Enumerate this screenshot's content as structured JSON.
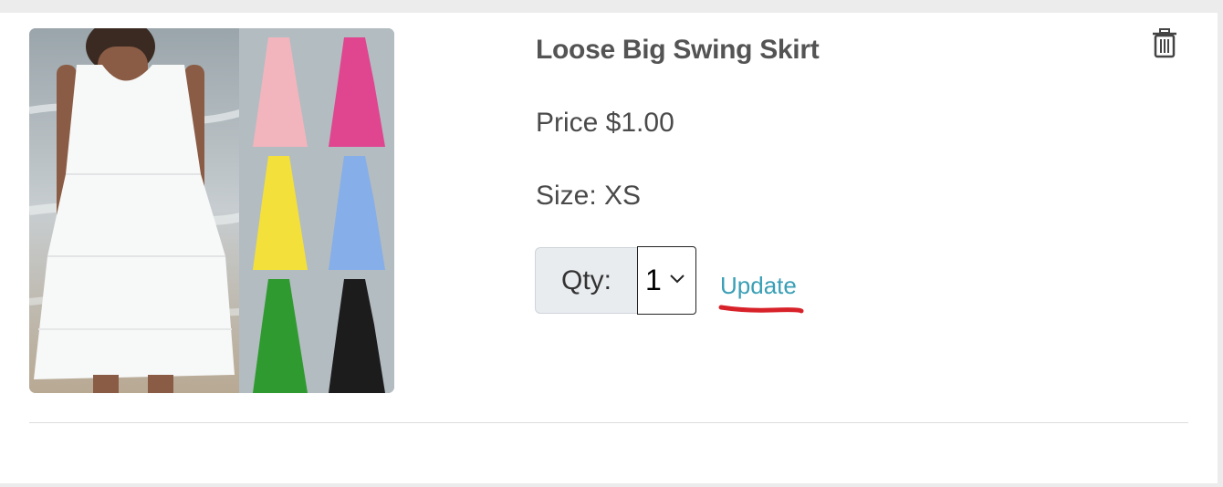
{
  "product": {
    "title": "Loose Big Swing Skirt",
    "price": "Price $1.00",
    "size": "Size: XS",
    "image_icon": "dress-photo",
    "color_variants": [
      "#f2b5bd",
      "#e0458f",
      "#f3e03a",
      "#86aee8",
      "#2f9a2f",
      "#1c1c1c"
    ]
  },
  "quantity": {
    "label": "Qty:",
    "selected": "1"
  },
  "actions": {
    "update_label": "Update",
    "delete_icon": "trash-icon"
  },
  "colors": {
    "link": "#3a9fb5",
    "annotation": "#d8222a"
  }
}
